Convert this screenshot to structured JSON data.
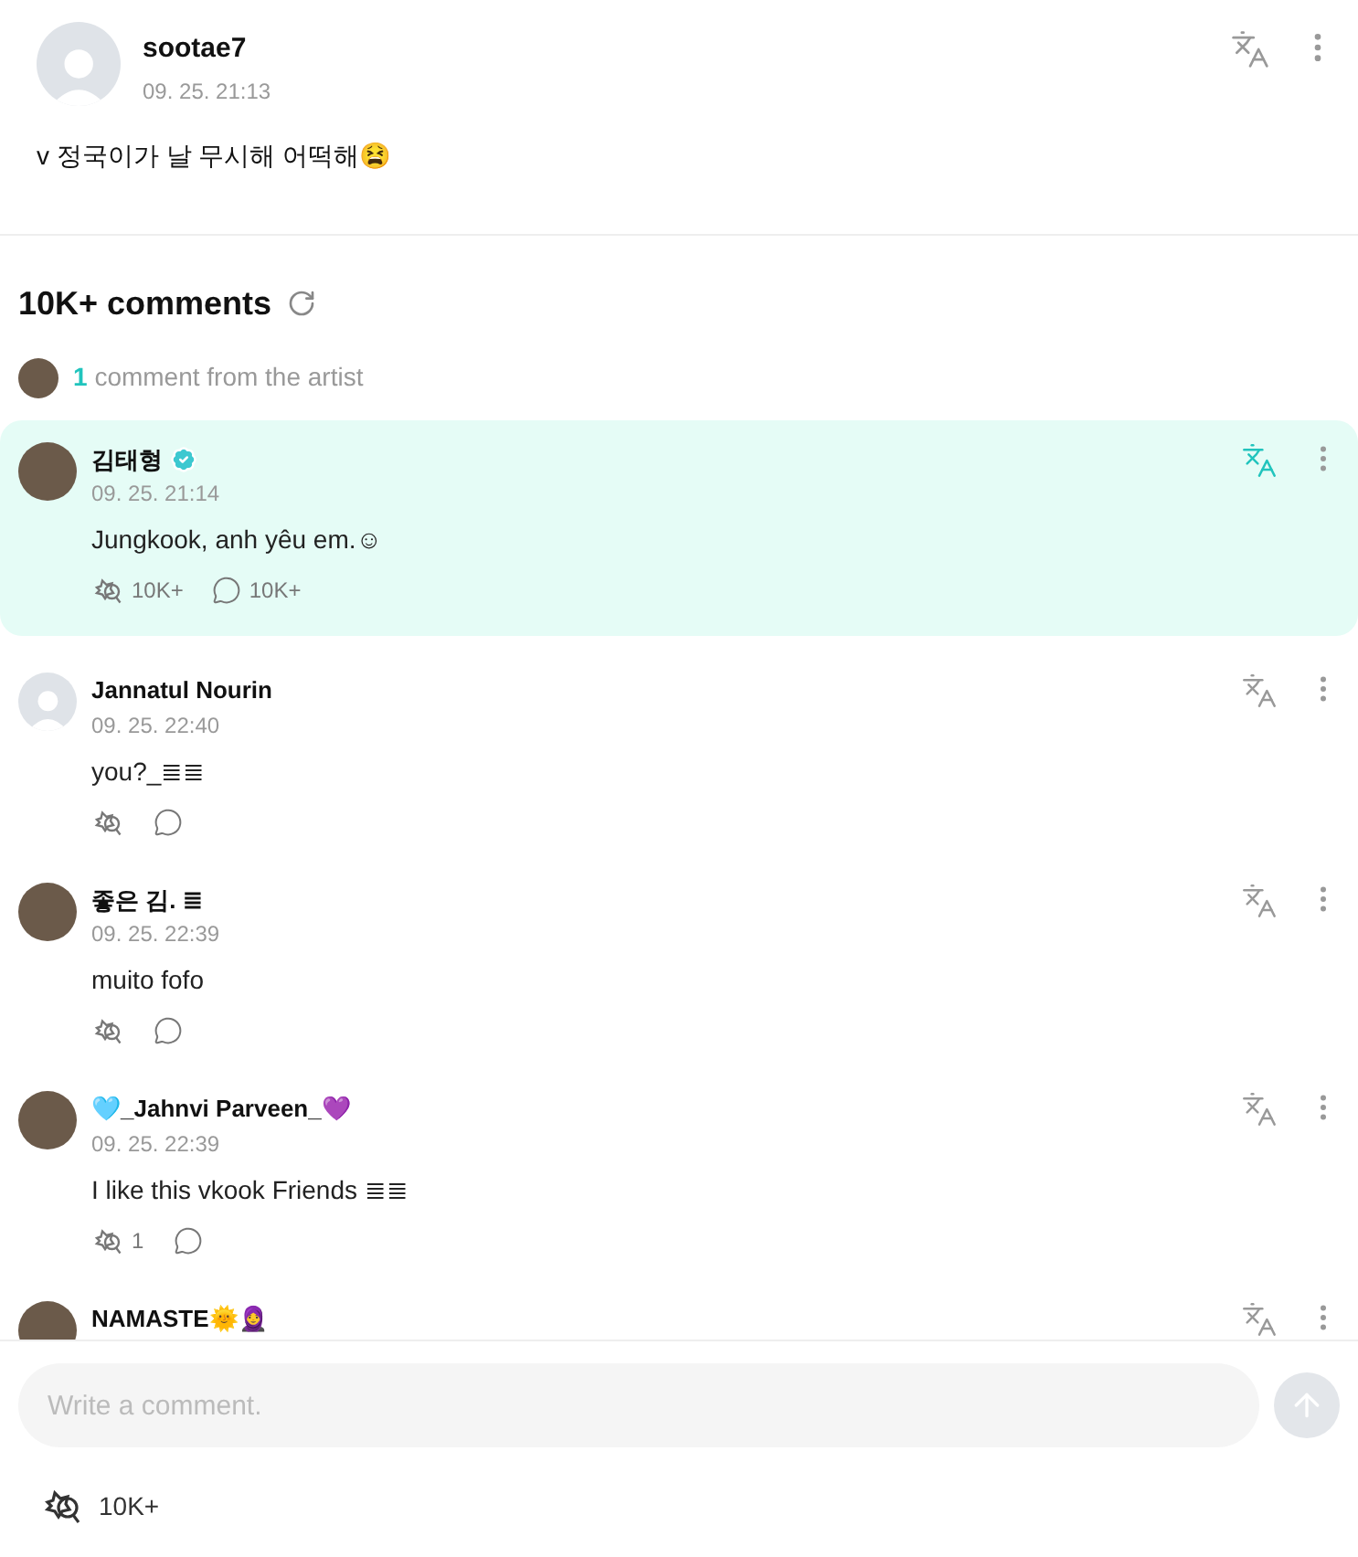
{
  "post": {
    "author": "sootae7",
    "time": "09. 25. 21:13",
    "text": "v 정국이가 날 무시해 어떡해😫"
  },
  "comments_header": {
    "title": "10K+ comments",
    "artist_count": "1",
    "artist_label": "comment from the artist"
  },
  "comments": [
    {
      "author": "김태형",
      "verified": true,
      "highlighted": true,
      "default_avatar": false,
      "time": "09. 25. 21:14",
      "text": "Jungkook, anh yêu em.☺",
      "reactions": "10K+",
      "replies": "10K+"
    },
    {
      "author": "Jannatul Nourin",
      "verified": false,
      "highlighted": false,
      "default_avatar": true,
      "time": "09. 25. 22:40",
      "text": "you?_≣≣"
    },
    {
      "author": "좋은 김. ≣",
      "verified": false,
      "highlighted": false,
      "default_avatar": false,
      "time": "09. 25. 22:39",
      "text": "muito fofo"
    },
    {
      "author": "🩵_Jahnvi Parveen_💜",
      "verified": false,
      "highlighted": false,
      "default_avatar": false,
      "time": "09. 25. 22:39",
      "text": "I like this vkook Friends ≣≣",
      "reactions": "1"
    },
    {
      "author": "NAMASTE🌞🧕",
      "verified": false,
      "highlighted": false,
      "default_avatar": false
    }
  ],
  "composer": {
    "placeholder": "Write a comment."
  },
  "footer": {
    "reactions": "10K+"
  }
}
